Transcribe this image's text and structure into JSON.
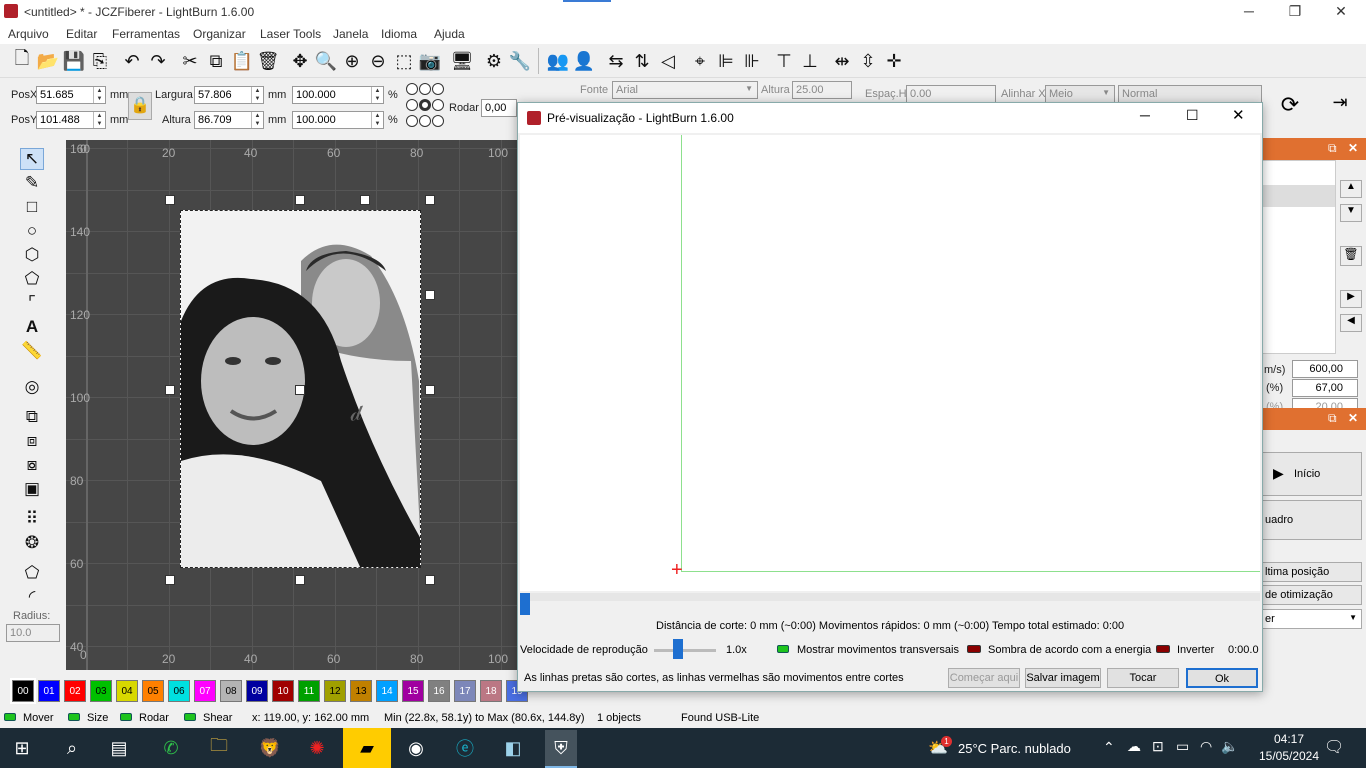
{
  "window": {
    "title": "<untitled> * - JCZFiberer - LightBurn 1.6.00",
    "minimize": "─",
    "maximize": "❐",
    "close": "✕"
  },
  "menu": [
    "Arquivo",
    "Editar",
    "Ferramentas",
    "Organizar",
    "Laser Tools",
    "Janela",
    "Idioma",
    "Ajuda"
  ],
  "props": {
    "posx_label": "PosX",
    "posx_value": "51.685",
    "posy_label": "PosY",
    "posy_value": "101.488",
    "unit": "mm",
    "largura_label": "Largura",
    "largura_value": "57.806",
    "altura_label": "Altura",
    "altura_value": "86.709",
    "pct1": "100.000",
    "pct2": "100.000",
    "pct": "%",
    "rodar_label": "Rodar",
    "rodar_value": "0,00",
    "fonte_label": "Fonte",
    "fonte_value": "Arial",
    "font_altura_label": "Altura",
    "font_altura_value": "25.00",
    "espac_label": "Espaç.H",
    "espac_value": "0.00",
    "alinhar_label": "Alinhar X",
    "alinhar_value": "Meio",
    "normal_value": "Normal"
  },
  "canvas": {
    "top_ruler": [
      "20",
      "40",
      "60",
      "80",
      "100"
    ],
    "bottom_ruler": [
      "20",
      "40",
      "60",
      "80",
      "100"
    ],
    "left_ruler": [
      "160",
      "140",
      "120",
      "100",
      "80",
      "60",
      "40"
    ],
    "corner_top": "0",
    "corner_bottom": "0"
  },
  "left_tools": {
    "radius_label": "Radius:",
    "radius_value": "10.0"
  },
  "right_panel": {
    "speed_label": "m/s)",
    "speed_value": "600,00",
    "power_label": "(%)",
    "power_value": "67,00",
    "power2_label": "(%)",
    "power2_value": "20,00",
    "inicio_label": "Início",
    "quadro_label": "uadro",
    "ultima_label": "ltima posição",
    "otim_label": "de otimização",
    "er_label": "er"
  },
  "palette": {
    "swatches": [
      {
        "label": "00",
        "color": "#000000",
        "text": "#ffffff"
      },
      {
        "label": "01",
        "color": "#0000ff",
        "text": "#ffffff"
      },
      {
        "label": "02",
        "color": "#ff0000",
        "text": "#ffffff"
      },
      {
        "label": "03",
        "color": "#00c000",
        "text": "#000000"
      },
      {
        "label": "04",
        "color": "#d8d800",
        "text": "#000000"
      },
      {
        "label": "05",
        "color": "#ff8000",
        "text": "#000000"
      },
      {
        "label": "06",
        "color": "#00e0e0",
        "text": "#000000"
      },
      {
        "label": "07",
        "color": "#ff00ff",
        "text": "#ffffff"
      },
      {
        "label": "08",
        "color": "#b4b4b4",
        "text": "#000000"
      },
      {
        "label": "09",
        "color": "#0000a0",
        "text": "#ffffff"
      },
      {
        "label": "10",
        "color": "#a00000",
        "text": "#ffffff"
      },
      {
        "label": "11",
        "color": "#00a000",
        "text": "#ffffff"
      },
      {
        "label": "12",
        "color": "#a0a000",
        "text": "#000000"
      },
      {
        "label": "13",
        "color": "#c08000",
        "text": "#000000"
      },
      {
        "label": "14",
        "color": "#00a0ff",
        "text": "#ffffff"
      },
      {
        "label": "15",
        "color": "#a000a0",
        "text": "#ffffff"
      },
      {
        "label": "16",
        "color": "#808080",
        "text": "#ffffff"
      },
      {
        "label": "17",
        "color": "#7d87b9",
        "text": "#ffffff"
      },
      {
        "label": "18",
        "color": "#bb7784",
        "text": "#ffffff"
      },
      {
        "label": "19",
        "color": "#4a6fe3",
        "text": "#ffffff"
      }
    ]
  },
  "status": {
    "mover": "Mover",
    "size": "Size",
    "rodar": "Rodar",
    "shear": "Shear",
    "coords": "x: 119.00, y: 162.00 mm",
    "range": "Min (22.8x, 58.1y) to Max (80.6x, 144.8y)",
    "objects": "1 objects",
    "device": "Found USB-Lite"
  },
  "preview": {
    "title": "Pré-visualização - LightBurn 1.6.00",
    "summary": "Distância de corte: 0 mm (~0:00) Movimentos rápidos: 0 mm (~0:00) Tempo total estimado: 0:00",
    "speed_label": "Velocidade de reprodução",
    "speed_value": "1.0x",
    "show_moves": "Mostrar movimentos transversais",
    "shade": "Sombra de acordo com a energia",
    "invert": "Inverter",
    "time": "0:00.0",
    "legend": "As linhas pretas são cortes, as linhas vermelhas são movimentos entre cortes",
    "start_here": "Começar aqui",
    "save_image": "Salvar imagem",
    "play": "Tocar",
    "ok": "Ok",
    "progress": 0
  },
  "taskbar": {
    "weather": "25°C  Parc. nublado",
    "time": "04:17",
    "date": "15/05/2024",
    "weather_badge": "1"
  }
}
